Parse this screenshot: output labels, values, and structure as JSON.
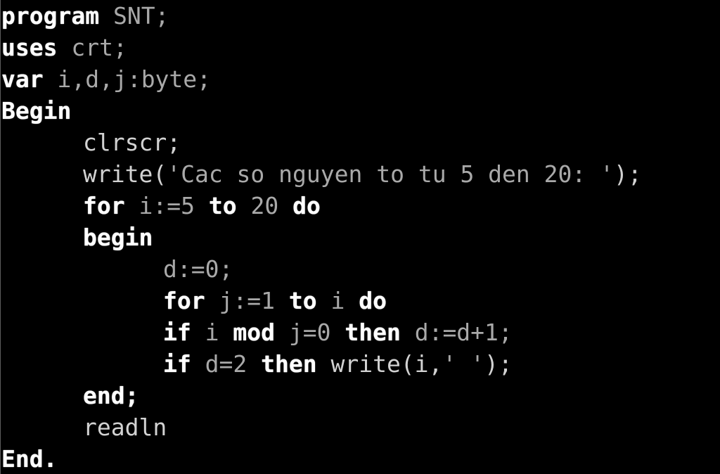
{
  "terminal": {
    "background_color": "#000000",
    "keyword_color": "#ffffff",
    "identifier_color": "#a9a9a9",
    "procedure_color": "#d2d2d2",
    "language": "Pascal",
    "program_name": "SNT"
  },
  "code": {
    "lines": [
      {
        "indent": 0,
        "tokens": [
          {
            "t": "program",
            "k": "kw"
          },
          {
            "t": " ",
            "k": "id"
          },
          {
            "t": "SNT;",
            "k": "id"
          }
        ]
      },
      {
        "indent": 0,
        "tokens": [
          {
            "t": "uses",
            "k": "kw"
          },
          {
            "t": " ",
            "k": "id"
          },
          {
            "t": "crt;",
            "k": "id"
          }
        ]
      },
      {
        "indent": 0,
        "tokens": [
          {
            "t": "var",
            "k": "kw"
          },
          {
            "t": " ",
            "k": "id"
          },
          {
            "t": "i,d,j:byte;",
            "k": "id"
          }
        ]
      },
      {
        "indent": 0,
        "tokens": [
          {
            "t": "Begin",
            "k": "kw"
          }
        ]
      },
      {
        "indent": 1,
        "tokens": [
          {
            "t": "clrscr;",
            "k": "proc"
          }
        ]
      },
      {
        "indent": 1,
        "tokens": [
          {
            "t": "write(",
            "k": "proc"
          },
          {
            "t": "'Cac so nguyen to tu 5 den 20: '",
            "k": "str"
          },
          {
            "t": ");",
            "k": "proc"
          }
        ]
      },
      {
        "indent": 1,
        "tokens": [
          {
            "t": "for",
            "k": "kw"
          },
          {
            "t": " ",
            "k": "id"
          },
          {
            "t": "i:=5",
            "k": "id"
          },
          {
            "t": " ",
            "k": "id"
          },
          {
            "t": "to",
            "k": "kw"
          },
          {
            "t": " ",
            "k": "id"
          },
          {
            "t": "20",
            "k": "id"
          },
          {
            "t": " ",
            "k": "id"
          },
          {
            "t": "do",
            "k": "kw"
          }
        ]
      },
      {
        "indent": 1,
        "tokens": [
          {
            "t": "begin",
            "k": "kw"
          }
        ]
      },
      {
        "indent": 2,
        "tokens": [
          {
            "t": "d:=0;",
            "k": "id"
          }
        ]
      },
      {
        "indent": 2,
        "tokens": [
          {
            "t": "for",
            "k": "kw"
          },
          {
            "t": " ",
            "k": "id"
          },
          {
            "t": "j:=1",
            "k": "id"
          },
          {
            "t": " ",
            "k": "id"
          },
          {
            "t": "to",
            "k": "kw"
          },
          {
            "t": " ",
            "k": "id"
          },
          {
            "t": "i",
            "k": "id"
          },
          {
            "t": " ",
            "k": "id"
          },
          {
            "t": "do",
            "k": "kw"
          }
        ]
      },
      {
        "indent": 2,
        "tokens": [
          {
            "t": "if",
            "k": "kw"
          },
          {
            "t": " ",
            "k": "id"
          },
          {
            "t": "i",
            "k": "id"
          },
          {
            "t": " ",
            "k": "id"
          },
          {
            "t": "mod",
            "k": "kw"
          },
          {
            "t": " ",
            "k": "id"
          },
          {
            "t": "j=0",
            "k": "id"
          },
          {
            "t": " ",
            "k": "id"
          },
          {
            "t": "then",
            "k": "kw"
          },
          {
            "t": " ",
            "k": "id"
          },
          {
            "t": "d:=d+1;",
            "k": "id"
          }
        ]
      },
      {
        "indent": 2,
        "tokens": [
          {
            "t": "if",
            "k": "kw"
          },
          {
            "t": " ",
            "k": "id"
          },
          {
            "t": "d=2",
            "k": "id"
          },
          {
            "t": " ",
            "k": "id"
          },
          {
            "t": "then",
            "k": "kw"
          },
          {
            "t": " ",
            "k": "id"
          },
          {
            "t": "write(i,",
            "k": "proc"
          },
          {
            "t": "' '",
            "k": "str"
          },
          {
            "t": ");",
            "k": "proc"
          }
        ]
      },
      {
        "indent": 1,
        "tokens": [
          {
            "t": "end;",
            "k": "kw"
          }
        ]
      },
      {
        "indent": 1,
        "tokens": [
          {
            "t": "readln",
            "k": "proc"
          }
        ]
      },
      {
        "indent": 0,
        "tokens": [
          {
            "t": "End.",
            "k": "kw"
          }
        ]
      }
    ]
  }
}
